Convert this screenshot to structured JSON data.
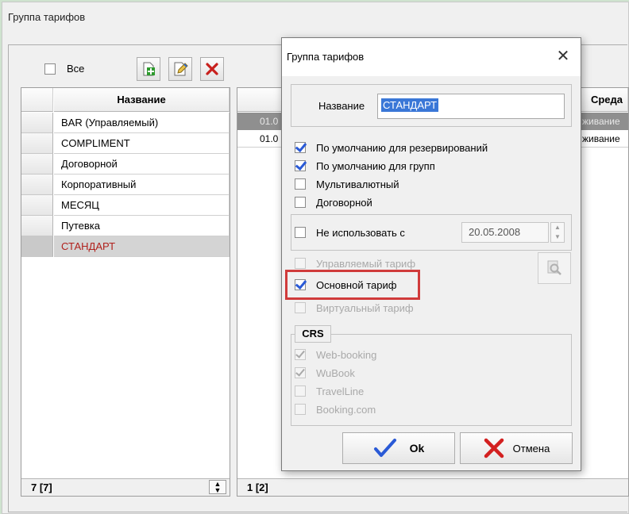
{
  "main_window": {
    "title": "Группа тарифов",
    "toolbar": {
      "all_label": "Все",
      "add_icon": "add-document-icon",
      "edit_icon": "edit-document-icon",
      "delete_icon": "delete-x-icon"
    },
    "left_grid": {
      "header": "Название",
      "rows": [
        "BAR (Управляемый)",
        "COMPLIMENT",
        "Договорной",
        "Корпоративный",
        "МЕСЯЦ",
        "Путевка",
        "СТАНДАРТ"
      ],
      "selected_row": "СТАНДАРТ",
      "footer": "7 [7]"
    },
    "right_grid": {
      "header_last": "Среда",
      "rows": [
        {
          "date": "01.0",
          "tail": "живание"
        },
        {
          "date": "01.0",
          "tail": "живание"
        }
      ],
      "footer": "1 [2]"
    }
  },
  "dialog": {
    "title": "Группа тарифов",
    "name_label": "Название",
    "name_value": "СТАНДАРТ",
    "options": {
      "default_reservations": "По умолчанию для резервирований",
      "default_groups": "По умолчанию для групп",
      "multicurrency": "Мультивалютный",
      "contract": "Договорной"
    },
    "not_use_label": "Не использовать с",
    "not_use_date": "20.05.2008",
    "managed_tariff": "Управляемый тариф",
    "base_tariff": "Основной тариф",
    "virtual_tariff": "Виртуальный тариф",
    "crs": {
      "title": "CRS",
      "items": [
        "Web-booking",
        "WuBook",
        "TravelLine",
        "Booking.com"
      ]
    },
    "ok_label": "Ok",
    "cancel_label": "Отмена",
    "colors": {
      "check_blue": "#2a5ad6",
      "highlight_red": "#d03b3b",
      "selection_blue": "#3a77d7",
      "cancel_red": "#d32020"
    }
  }
}
